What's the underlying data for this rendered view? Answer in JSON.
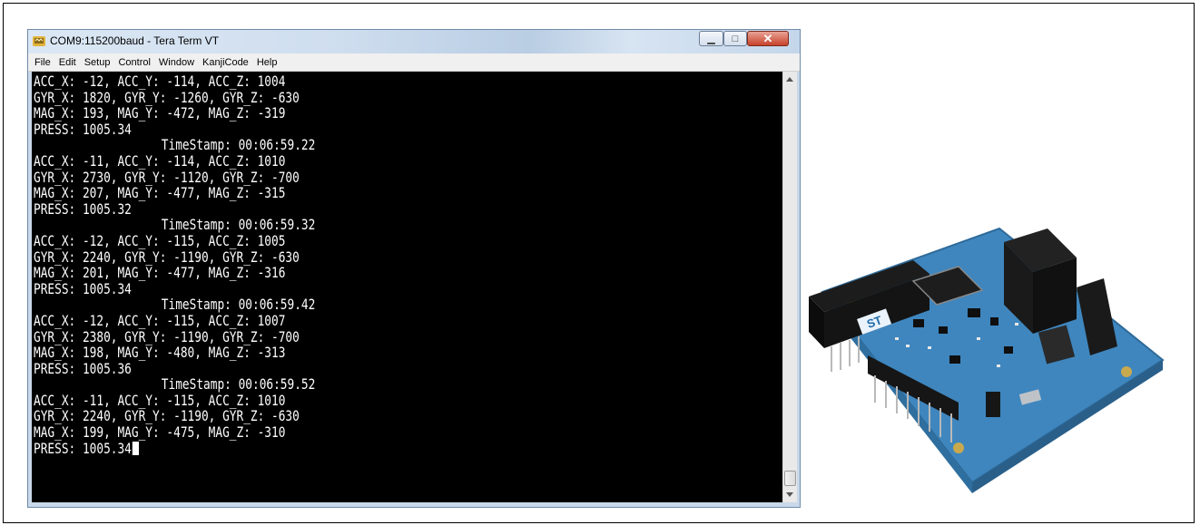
{
  "window": {
    "title": "COM9:115200baud - Tera Term VT",
    "controls": {
      "minimize": "▁",
      "maximize": "□",
      "close": "✕"
    }
  },
  "menu": [
    "File",
    "Edit",
    "Setup",
    "Control",
    "Window",
    "KanjiCode",
    "Help"
  ],
  "terminal": {
    "lines": [
      "ACC_X: -12, ACC_Y: -114, ACC_Z: 1004",
      "GYR_X: 1820, GYR_Y: -1260, GYR_Z: -630",
      "MAG_X: 193, MAG_Y: -472, MAG_Z: -319",
      "PRESS: 1005.34",
      "TimeStamp: 00:06:59.22",
      "ACC_X: -11, ACC_Y: -114, ACC_Z: 1010",
      "GYR_X: 2730, GYR_Y: -1120, GYR_Z: -700",
      "MAG_X: 207, MAG_Y: -477, MAG_Z: -315",
      "PRESS: 1005.32",
      "TimeStamp: 00:06:59.32",
      "ACC_X: -12, ACC_Y: -115, ACC_Z: 1005",
      "GYR_X: 2240, GYR_Y: -1190, GYR_Z: -630",
      "MAG_X: 201, MAG_Y: -477, MAG_Z: -316",
      "PRESS: 1005.34",
      "TimeStamp: 00:06:59.42",
      "ACC_X: -12, ACC_Y: -115, ACC_Z: 1007",
      "GYR_X: 2380, GYR_Y: -1190, GYR_Z: -700",
      "MAG_X: 198, MAG_Y: -480, MAG_Z: -313",
      "PRESS: 1005.36",
      "TimeStamp: 00:06:59.52",
      "ACC_X: -11, ACC_Y: -115, ACC_Z: 1010",
      "GYR_X: 2240, GYR_Y: -1190, GYR_Z: -630",
      "MAG_X: 199, MAG_Y: -475, MAG_Z: -310",
      "PRESS: 1005.34"
    ]
  },
  "colors": {
    "terminal_bg": "#000000",
    "terminal_fg": "#ffffff",
    "board_pcb": "#3f86be",
    "header_black": "#1c1c1c"
  },
  "icons": {
    "app_icon": "tera-term-icon",
    "scroll_up": "chevron-up-icon",
    "scroll_down": "chevron-down-icon"
  },
  "board": {
    "logo": "ST"
  }
}
